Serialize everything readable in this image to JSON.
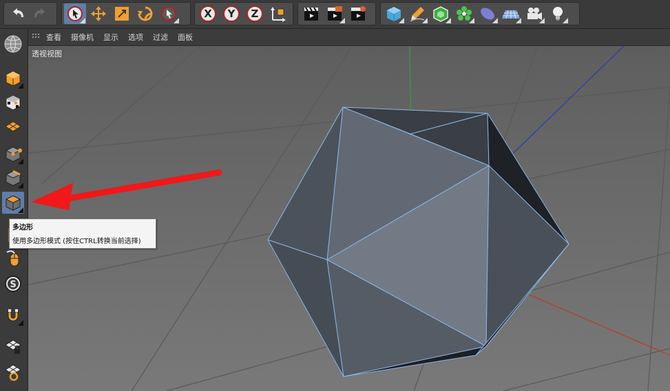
{
  "menubar": {
    "items": [
      "查看",
      "摄像机",
      "显示",
      "选项",
      "过滤",
      "面板"
    ]
  },
  "viewport": {
    "label": "透视视图"
  },
  "tooltip": {
    "title": "多边形",
    "description": "使用多边形模式 (按住CTRL转换当前选择)"
  },
  "toolbar": {
    "axis_labels": {
      "x": "X",
      "y": "Y",
      "z": "Z"
    }
  },
  "sidebar": {
    "selected_mode": "polygon-mode"
  },
  "colors": {
    "accent": "#5f7ea8",
    "object_edges": "#8ab4e6",
    "arrow": "#f01818",
    "axis_x": "#c0392b",
    "axis_y": "#2ea62e",
    "axis_z": "#2b3bb8"
  }
}
